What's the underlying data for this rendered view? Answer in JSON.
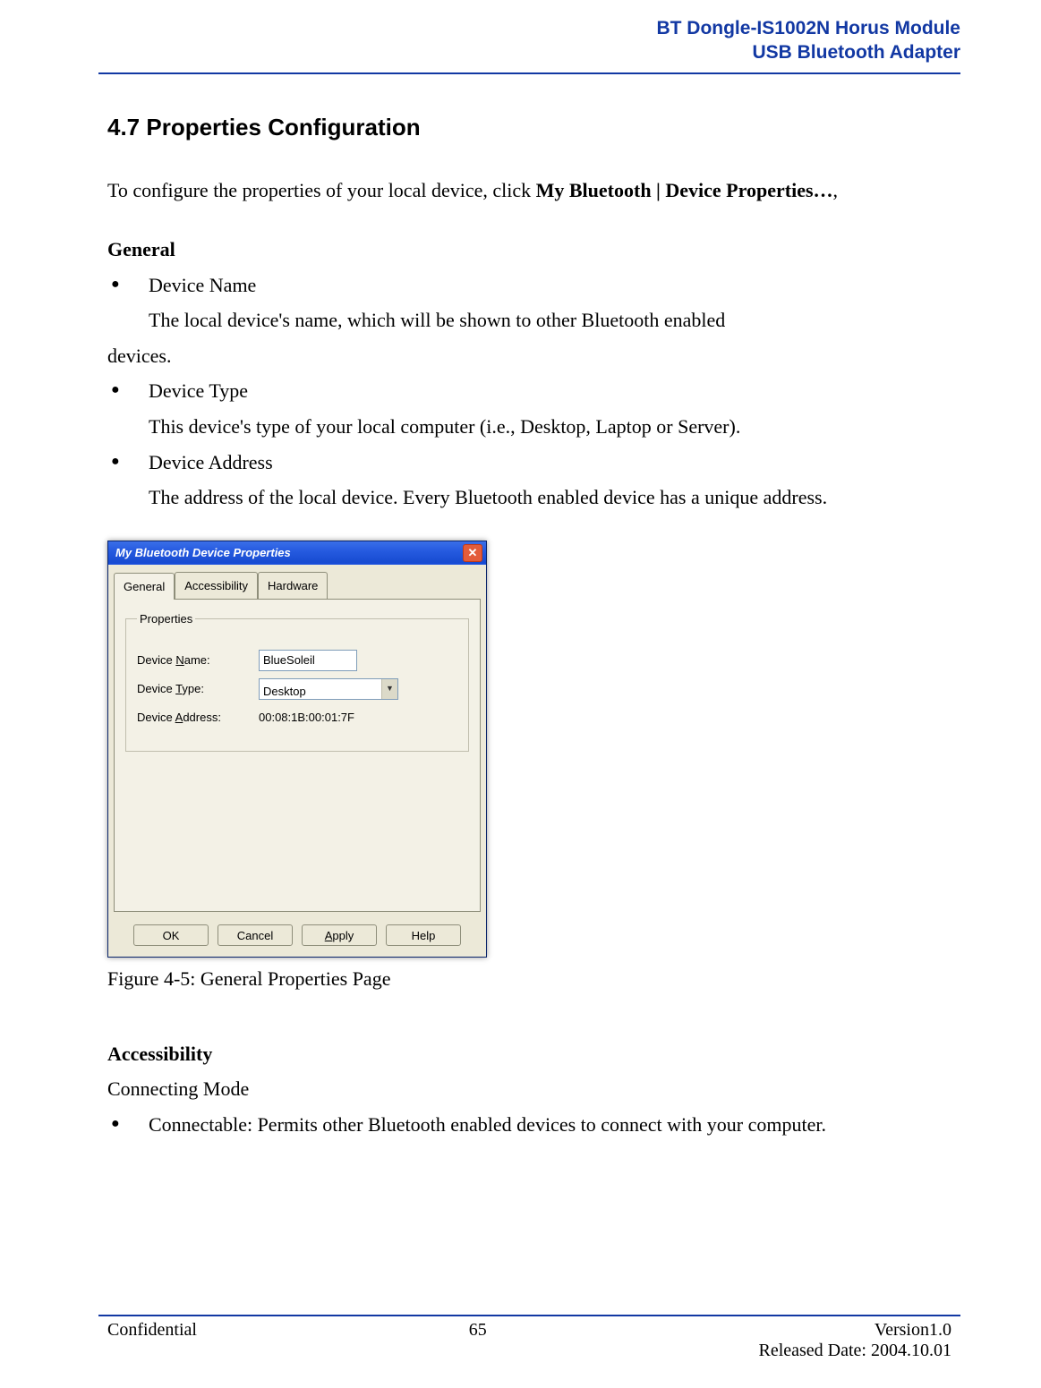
{
  "header": {
    "line1": "BT Dongle-IS1002N Horus Module",
    "line2": "USB Bluetooth Adapter"
  },
  "section": {
    "title": "4.7 Properties Configuration",
    "intro_pre": "To configure the properties of your local device, click ",
    "intro_bold1": "My Bluetooth | Device Properties…",
    "intro_post": ","
  },
  "general": {
    "heading": "General",
    "items": [
      {
        "name": "Device Name",
        "desc": "The local device's name, which will be shown to other Bluetooth enabled devices.",
        "desc_unindent_tail": true
      },
      {
        "name": "Device Type",
        "desc": "This device's type of your local computer (i.e., Desktop, Laptop or Server)."
      },
      {
        "name": "Device Address",
        "desc": "The address of the local device. Every Bluetooth enabled device has a unique address."
      }
    ]
  },
  "dialog": {
    "title": "My Bluetooth Device Properties",
    "tabs": [
      "General",
      "Accessibility",
      "Hardware"
    ],
    "active_tab": "General",
    "fieldset_legend": "Properties",
    "fields": {
      "name_label_pre": "Device ",
      "name_label_u": "N",
      "name_label_post": "ame:",
      "name_value": "BlueSoleil",
      "type_label_pre": "Device ",
      "type_label_u": "T",
      "type_label_post": "ype:",
      "type_value": "Desktop",
      "addr_label_pre": "Device ",
      "addr_label_u": "A",
      "addr_label_post": "ddress:",
      "addr_value": "00:08:1B:00:01:7F"
    },
    "buttons": {
      "ok": "OK",
      "cancel": "Cancel",
      "apply_u": "A",
      "apply_post": "pply",
      "help": "Help"
    }
  },
  "figure_caption": "Figure 4-5: General Properties Page",
  "accessibility": {
    "heading": "Accessibility",
    "subheading": "Connecting Mode",
    "item1": "Connectable: Permits other Bluetooth enabled devices to connect with your computer."
  },
  "footer": {
    "left": "Confidential",
    "page": "65",
    "right1": "Version1.0",
    "right2": "Released Date: 2004.10.01"
  }
}
